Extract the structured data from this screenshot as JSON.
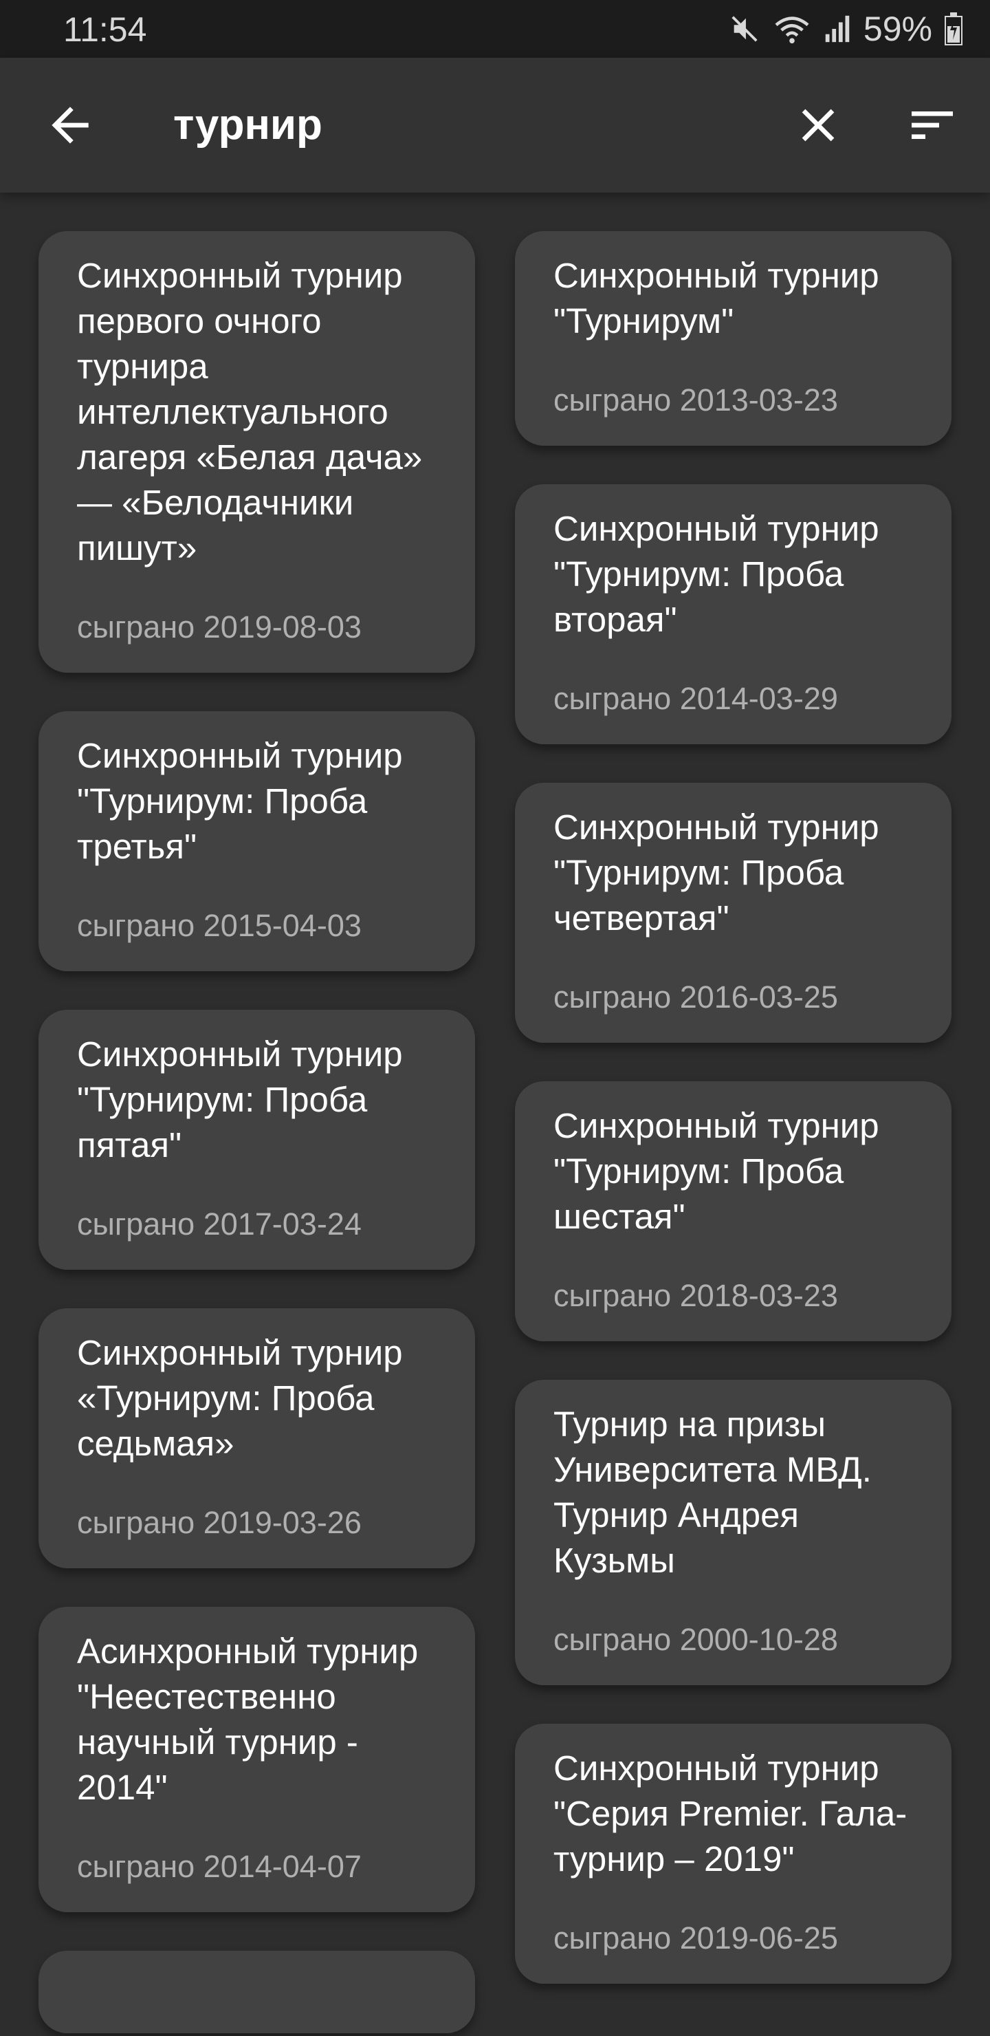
{
  "status_bar": {
    "time": "11:54",
    "battery": "59%",
    "icons": [
      "mute-icon",
      "wifi-icon",
      "signal-icon",
      "battery-icon"
    ]
  },
  "app_bar": {
    "query": "турнир",
    "icons": [
      "back-arrow-icon",
      "close-icon",
      "sort-icon"
    ]
  },
  "results": {
    "left": [
      {
        "title": "Синхронный турнир первого очного турнира интеллектуального лагеря «Белая дача» — «Белодачники пишут»",
        "date": "сыграно 2019-08-03"
      },
      {
        "title": "Синхронный турнир \"Турнирум: Проба третья\"",
        "date": "сыграно 2015-04-03"
      },
      {
        "title": "Синхронный турнир \"Турнирум: Проба пятая\"",
        "date": "сыграно 2017-03-24"
      },
      {
        "title": "Синхронный турнир «Турнирум: Проба седьмая»",
        "date": "сыграно 2019-03-26"
      },
      {
        "title": "Асинхронный турнир \"Неестественно научный турнир - 2014\"",
        "date": "сыграно 2014-04-07"
      }
    ],
    "right": [
      {
        "title": "Синхронный турнир \"Турнирум\"",
        "date": "сыграно 2013-03-23"
      },
      {
        "title": "Синхронный турнир \"Турнирум: Проба вторая\"",
        "date": "сыграно 2014-03-29"
      },
      {
        "title": "Синхронный турнир \"Турнирум: Проба четвертая\"",
        "date": "сыграно 2016-03-25"
      },
      {
        "title": "Синхронный турнир \"Турнирум: Проба шестая\"",
        "date": "сыграно 2018-03-23"
      },
      {
        "title": "Турнир на призы Университета МВД. Турнир Андрея Кузьмы",
        "date": "сыграно 2000-10-28"
      },
      {
        "title": "Синхронный турнир \"Серия Premier. Гала-турнир – 2019\"",
        "date": "сыграно 2019-06-25"
      }
    ]
  },
  "colors": {
    "background": "#2d2d2d",
    "app_bar": "#333333",
    "card": "#424242",
    "secondary_text": "#b0b0b0"
  }
}
